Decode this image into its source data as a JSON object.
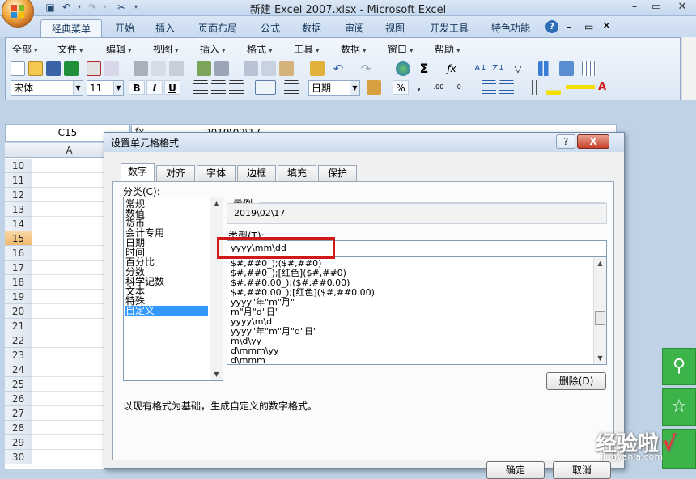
{
  "window": {
    "title": "新建 Excel 2007.xlsx - Microsoft Excel"
  },
  "ribbon": {
    "tabs": [
      "经典菜单",
      "开始",
      "插入",
      "页面布局",
      "公式",
      "数据",
      "审阅",
      "视图",
      "开发工具",
      "特色功能"
    ],
    "active_tab": 0,
    "menus": [
      "全部",
      "文件",
      "编辑",
      "视图",
      "插入",
      "格式",
      "工具",
      "数据",
      "窗口",
      "帮助"
    ],
    "font_name": "宋体",
    "font_size": "11",
    "number_format": "日期",
    "bold": "B",
    "italic": "I",
    "underline": "U",
    "percent": "%"
  },
  "formula": {
    "cell_ref": "C15",
    "content": "2019\\02\\17"
  },
  "grid": {
    "column": "A",
    "rows": [
      "10",
      "11",
      "12",
      "13",
      "14",
      "15",
      "16",
      "17",
      "18",
      "19",
      "20",
      "21",
      "22",
      "23",
      "24",
      "25",
      "26",
      "27",
      "28",
      "29",
      "30"
    ],
    "selected_row": "15"
  },
  "dialog": {
    "title": "设置单元格格式",
    "help": "?",
    "close": "X",
    "tabs": [
      "数字",
      "对齐",
      "字体",
      "边框",
      "填充",
      "保护"
    ],
    "active_tab": 0,
    "category_label": "分类(C):",
    "categories": [
      "常规",
      "数值",
      "货币",
      "会计专用",
      "日期",
      "时间",
      "百分比",
      "分数",
      "科学记数",
      "文本",
      "特殊",
      "自定义"
    ],
    "selected_category": "自定义",
    "sample_label": "示例",
    "sample_value": "2019\\02\\17",
    "type_label": "类型(T):",
    "type_value": "yyyy\\mm\\dd",
    "formats": [
      "$#,##0_);($#,##0)",
      "$#,##0_);[红色]($#,##0)",
      "$#,##0.00_);($#,##0.00)",
      "$#,##0.00_);[红色]($#,##0.00)",
      "yyyy\"年\"m\"月\"",
      "m\"月\"d\"日\"",
      "yyyy\\m\\d",
      "yyyy\"年\"m\"月\"d\"日\"",
      "m\\d\\yy",
      "d\\mmm\\yy",
      "d\\mmm"
    ],
    "delete_button": "删除(D)",
    "description": "以现有格式为基础，生成自定义的数字格式。",
    "ok_button": "确定",
    "cancel_button": "取消"
  },
  "watermark": {
    "text": "经验啦",
    "url": "jingyanla.com",
    "check": "√"
  },
  "colors": {
    "accent": "#3399ff",
    "highlight_box": "#d01818",
    "side_green": "#3cb44a"
  }
}
